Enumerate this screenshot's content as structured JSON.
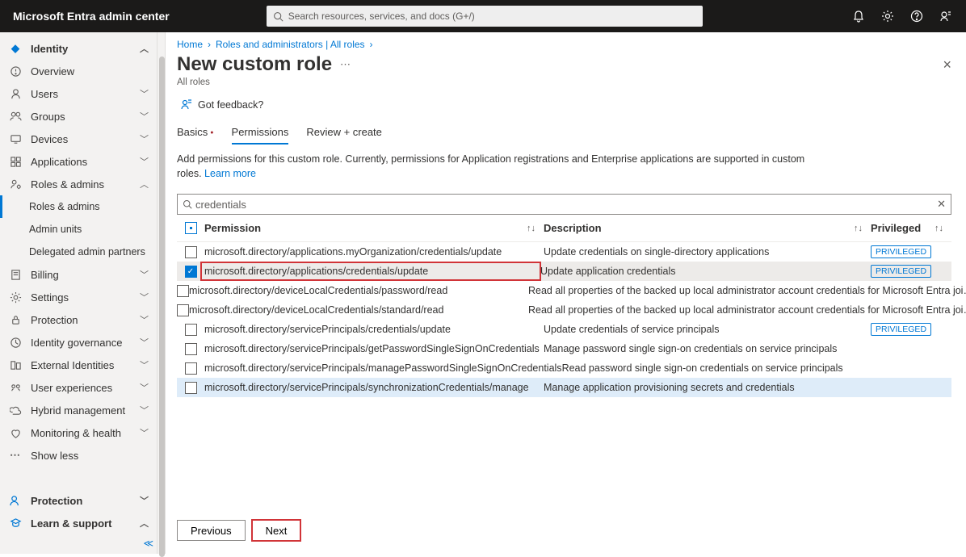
{
  "topbar": {
    "title": "Microsoft Entra admin center",
    "search_placeholder": "Search resources, services, and docs (G+/)"
  },
  "sidebar": {
    "identity": {
      "label": "Identity",
      "items": [
        {
          "icon": "overview",
          "label": "Overview"
        },
        {
          "icon": "users",
          "label": "Users",
          "chev": true
        },
        {
          "icon": "groups",
          "label": "Groups",
          "chev": true
        },
        {
          "icon": "devices",
          "label": "Devices",
          "chev": true
        },
        {
          "icon": "apps",
          "label": "Applications",
          "chev": true
        },
        {
          "icon": "roles",
          "label": "Roles & admins",
          "chev": true,
          "expanded": true,
          "children": [
            {
              "label": "Roles & admins",
              "active": true
            },
            {
              "label": "Admin units"
            },
            {
              "label": "Delegated admin partners"
            }
          ]
        },
        {
          "icon": "billing",
          "label": "Billing",
          "chev": true
        },
        {
          "icon": "settings",
          "label": "Settings",
          "chev": true
        },
        {
          "icon": "protection",
          "label": "Protection",
          "chev": true
        },
        {
          "icon": "governance",
          "label": "Identity governance",
          "chev": true
        },
        {
          "icon": "external",
          "label": "External Identities",
          "chev": true
        },
        {
          "icon": "ux",
          "label": "User experiences",
          "chev": true
        },
        {
          "icon": "hybrid",
          "label": "Hybrid management",
          "chev": true
        },
        {
          "icon": "health",
          "label": "Monitoring & health",
          "chev": true
        },
        {
          "icon": "showless",
          "label": "Show less"
        }
      ]
    },
    "protection": {
      "label": "Protection",
      "icon": "protection2"
    },
    "learn": {
      "label": "Learn & support",
      "icon": "learn"
    }
  },
  "breadcrumb": [
    {
      "text": "Home"
    },
    {
      "text": "Roles and administrators | All roles"
    }
  ],
  "page": {
    "title": "New custom role",
    "subtitle": "All roles",
    "feedback": "Got feedback?",
    "close": "×"
  },
  "tabs": [
    {
      "label": "Basics",
      "dot": true
    },
    {
      "label": "Permissions",
      "active": true
    },
    {
      "label": "Review + create"
    }
  ],
  "info": {
    "text": "Add permissions for this custom role. Currently, permissions for Application registrations and Enterprise applications are supported in custom roles. ",
    "link": "Learn more"
  },
  "filter": {
    "value": "credentials"
  },
  "columns": {
    "permission": "Permission",
    "description": "Description",
    "privileged": "Privileged"
  },
  "privileged_label": "PRIVILEGED",
  "rows": [
    {
      "perm": "microsoft.directory/applications.myOrganization/credentials/update",
      "desc": "Update credentials on single-directory applications",
      "priv": true,
      "checked": false
    },
    {
      "perm": "microsoft.directory/applications/credentials/update",
      "desc": "Update application credentials",
      "priv": true,
      "checked": true,
      "selected": true,
      "highlight": true
    },
    {
      "perm": "microsoft.directory/deviceLocalCredentials/password/read",
      "desc": "Read all properties of the backed up local administrator account credentials for Microsoft Entra joi…",
      "priv": false,
      "checked": false
    },
    {
      "perm": "microsoft.directory/deviceLocalCredentials/standard/read",
      "desc": "Read all properties of the backed up local administrator account credentials for Microsoft Entra joi…",
      "priv": false,
      "checked": false
    },
    {
      "perm": "microsoft.directory/servicePrincipals/credentials/update",
      "desc": "Update credentials of service principals",
      "priv": true,
      "checked": false
    },
    {
      "perm": "microsoft.directory/servicePrincipals/getPasswordSingleSignOnCredentials",
      "desc": "Manage password single sign-on credentials on service principals",
      "priv": false,
      "checked": false
    },
    {
      "perm": "microsoft.directory/servicePrincipals/managePasswordSingleSignOnCredentials",
      "desc": "Read password single sign-on credentials on service principals",
      "priv": false,
      "checked": false
    },
    {
      "perm": "microsoft.directory/servicePrincipals/synchronizationCredentials/manage",
      "desc": "Manage application provisioning secrets and credentials",
      "priv": false,
      "checked": false,
      "hover": true
    }
  ],
  "buttons": {
    "previous": "Previous",
    "next": "Next"
  }
}
